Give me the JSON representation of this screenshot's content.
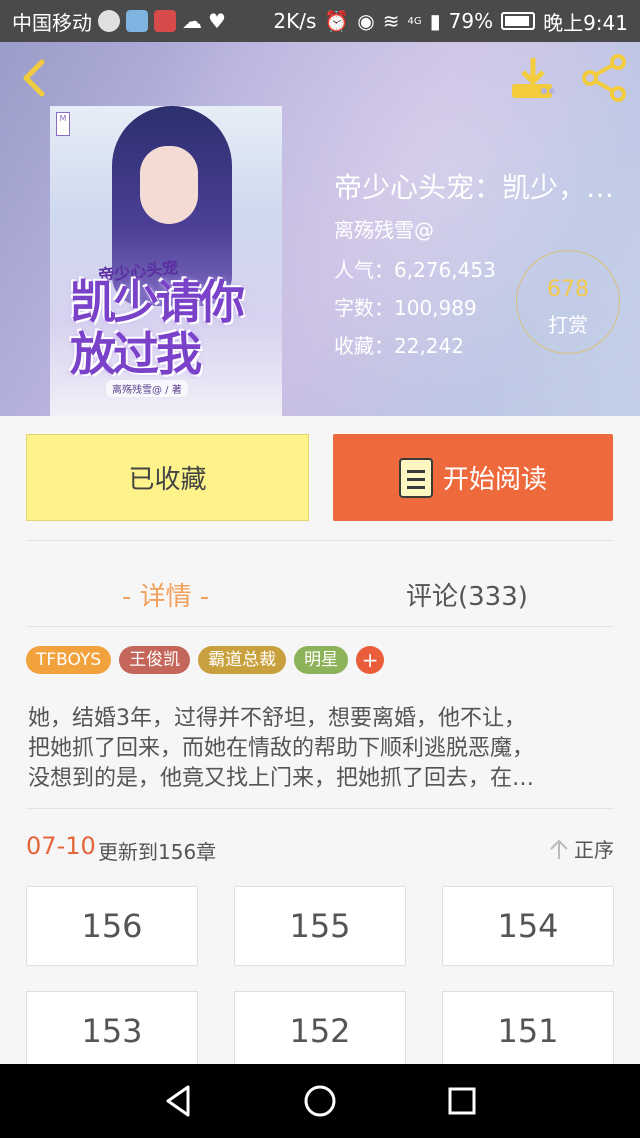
{
  "status_bar": {
    "carrier": "中国移动",
    "speed": "2K/s",
    "network": "4G",
    "battery": "79%",
    "time": "晚上9:41"
  },
  "header": {
    "book_title": "帝少心头宠：凯少，…",
    "author": "离殇残雪@",
    "stats": {
      "popularity_label": "人气：",
      "popularity": "6,276,453",
      "words_label": "字数：",
      "words": "100,989",
      "favorites_label": "收藏：",
      "favorites": "22,242"
    },
    "reward_count": "678",
    "reward_label": "打赏",
    "cover": {
      "small_title": "帝少心头宠",
      "big_title": "凯少请你放过我",
      "author_strip": "离殇残雪@ / 著"
    }
  },
  "actions": {
    "collected_label": "已收藏",
    "read_label": "开始阅读"
  },
  "tabs": {
    "detail": "- 详情 -",
    "comments": "评论(333)"
  },
  "tags": [
    {
      "label": "TFBOYS",
      "color": "#f2a23c"
    },
    {
      "label": "王俊凯",
      "color": "#c4665a"
    },
    {
      "label": "霸道总裁",
      "color": "#c9a03e"
    },
    {
      "label": "明星",
      "color": "#8db35a"
    }
  ],
  "tag_more": "+",
  "synopsis": [
    "她，结婚3年，过得并不舒坦，想要离婚，他不让，",
    "把她抓了回来，而她在情敌的帮助下顺利逃脱恶魔，",
    "没想到的是，他竟又找上门来，把她抓了回去，在…"
  ],
  "update": {
    "date": "07-10",
    "text": "更新到156章",
    "sort_label": "正序"
  },
  "chapters": [
    "156",
    "155",
    "154",
    "153",
    "152",
    "151"
  ],
  "colors": {
    "accent_orange": "#ee6a3d",
    "collected_yellow": "#fdf38a",
    "tab_active": "#f2a15e",
    "icon_yellow": "#f2cc3c"
  }
}
